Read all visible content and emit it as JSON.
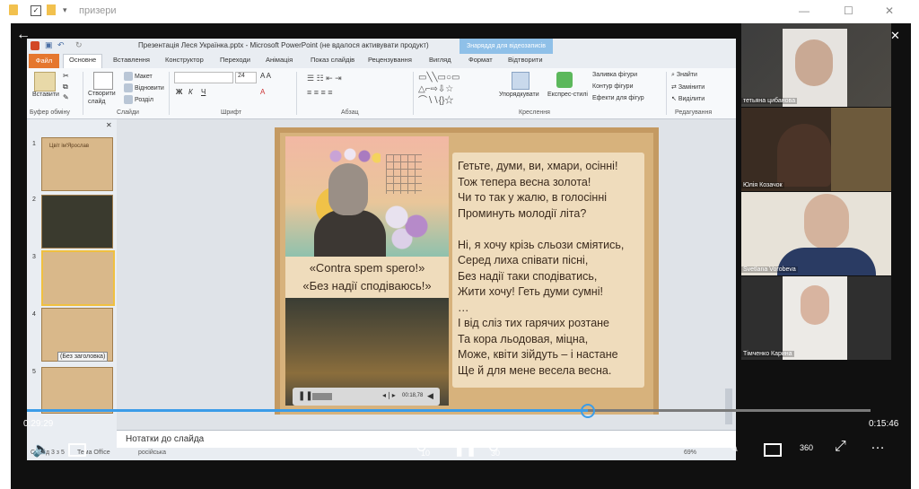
{
  "explorer": {
    "title": "призери"
  },
  "ppt": {
    "title": "Презентація Леся Українка.pptx - Microsoft PowerPoint (не вдалося активувати продукт)",
    "contextual_tab": "Знаряддя для відеозаписів",
    "tabs": [
      "Файл",
      "Основне",
      "Вставлення",
      "Конструктор",
      "Переходи",
      "Анімація",
      "Показ слайдів",
      "Рецензування",
      "Вигляд",
      "Формат",
      "Відтворити"
    ],
    "ribbon": {
      "paste": "Вставити",
      "clipboard": "Буфер обміну",
      "new_slide": "Створити слайд",
      "layout": "Макет",
      "restore": "Відновити",
      "section": "Розділ",
      "slides_group": "Слайди",
      "font_size": "24",
      "font_group": "Шрифт",
      "paragraph_group": "Абзац",
      "arrange": "Упорядкувати",
      "quick_styles": "Експрес-стилі",
      "shape_fill": "Заливка фігури",
      "shape_outline": "Контур фігури",
      "shape_effects": "Ефекти для фігур",
      "drawing_group": "Креслення",
      "find": "Знайти",
      "replace": "Замінити",
      "select": "Виділити",
      "editing_group": "Редагування"
    },
    "thumbs": {
      "n1": "1",
      "n2": "2",
      "n3": "3",
      "n4": "4",
      "n5": "5",
      "t1_title": "Цвіт ім'Ярослав",
      "tooltip": "(Без заголовка)"
    },
    "slide": {
      "quote1": "«Contra spem spero!»",
      "quote2": "«Без надії сподіваюсь!»",
      "video_time": "00:18,78",
      "poem": [
        "Гетьте, думи, ви, хмари, осінні!",
        "Тож тепера весна золота!",
        "Чи то так у жалю, в голосінні",
        "Проминуть молодії літа?",
        "",
        "Ні, я хочу крізь сльози сміятись,",
        "Серед лиха співати пісні,",
        "Без надії таки сподіватись,",
        "Жити хочу! Геть думи сумні!",
        "…",
        "І від сліз тих гарячих розтане",
        "Та кора льодовая, міцна,",
        "Може, квіти зійдуть – і настане",
        "Ще й для мене весела весна."
      ]
    },
    "notes_placeholder": "Нотатки до слайда",
    "status": {
      "slide": "Слайд 3 з 5",
      "theme": "Тема Office",
      "language": "російська",
      "zoom": "69%"
    }
  },
  "participants": [
    {
      "name": "тетьяна цибанова"
    },
    {
      "name": "Юлія Козачок"
    },
    {
      "name": "Svetlana Vorobeva"
    },
    {
      "name": "Тімченко Карина"
    }
  ],
  "player": {
    "current_time": "0:29:29",
    "total_time": "0:15:46",
    "progress": 0.665,
    "rewind_label": "10",
    "forward_label": "30",
    "vr_label": "360"
  },
  "colors": {
    "seek": "#3b9ce8",
    "file_tab": "#e5772e",
    "ctx_tab": "#8fc0e8"
  }
}
